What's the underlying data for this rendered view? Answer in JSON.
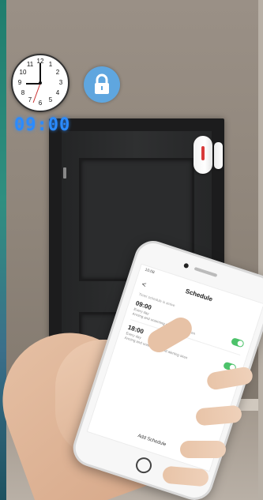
{
  "digital_clock": {
    "time": "09:00"
  },
  "analog_clock": {
    "numbers": [
      "12",
      "1",
      "2",
      "3",
      "4",
      "5",
      "6",
      "7",
      "8",
      "9",
      "10",
      "11"
    ]
  },
  "lock_icon": "lock-icon",
  "phone": {
    "status_time": "10:08",
    "title": "Schedule",
    "back_symbol": "<",
    "hint": "Timer schedule is active",
    "schedules": [
      {
        "time": "09:00",
        "repeat": "Every day",
        "action": "Arming and unarming sound alerting siren",
        "enabled": true
      },
      {
        "time": "18:00",
        "repeat": "Every day",
        "action": "Arming and unarming sound alerting siren",
        "enabled": true
      }
    ],
    "add_label": "Add Schedule"
  },
  "colors": {
    "toggle_on": "#4cc26a",
    "lock_badge": "#5fa6df",
    "digital": "#2b8bff"
  }
}
